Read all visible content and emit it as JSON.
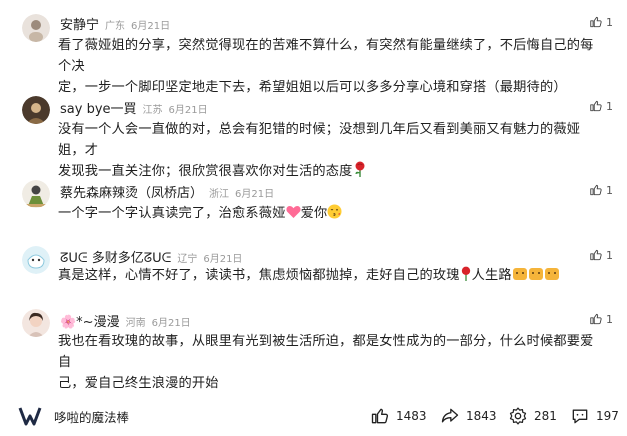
{
  "comments": [
    {
      "name": "安静宁",
      "location": "广东",
      "date": "6月21日",
      "likes": "1",
      "lines": [
        "看了薇娅姐的分享，突然觉得现在的苦难不算什么，有突然有能量继续了，不后悔自己的每个决",
        "定，一步一个脚印坚定地走下去，希望姐姐以后可以多多分享心境和穿搭（最期待的）"
      ]
    },
    {
      "name": "say bye一買",
      "location": "江苏",
      "date": "6月21日",
      "likes": "1",
      "lines": [
        "没有一个人会一直做的对，总会有犯错的时候；没想到几年后又看到美丽又有魅力的薇娅姐，才",
        "发现我一直关注你；很欣赏很喜欢你对生活的态度"
      ]
    },
    {
      "name": "蔡先森麻辣烫（凤桥店）",
      "location": "浙江",
      "date": "6月21日",
      "likes": "1",
      "lines": [
        "一个字一个字认真读完了，治愈系薇娅",
        "爱你"
      ]
    },
    {
      "name": "ᘔᑌᕮ 多财多亿ᘔᑌᕮ",
      "location": "辽宁",
      "date": "6月21日",
      "likes": "1",
      "lines": [
        "真是这样，心情不好了，读读书，焦虑烦恼都抛掉，走好自己的玫瑰",
        "人生路"
      ]
    },
    {
      "name": "🌸*~漫漫",
      "location": "河南",
      "date": "6月21日",
      "likes": "1",
      "lines": [
        "我也在看玫瑰的故事，从眼里有光到被生活所迫，都是女性成为的一部分，什么时候都要爱自",
        "己，爱自己终生浪漫的开始"
      ]
    }
  ],
  "footer": {
    "brand_name": "哆啦的魔法棒",
    "likes": "1483",
    "shares": "1843",
    "favorites": "281",
    "comments": "197"
  },
  "colors": {
    "meta": "#9a9a9a",
    "text": "#1e1e1e"
  }
}
